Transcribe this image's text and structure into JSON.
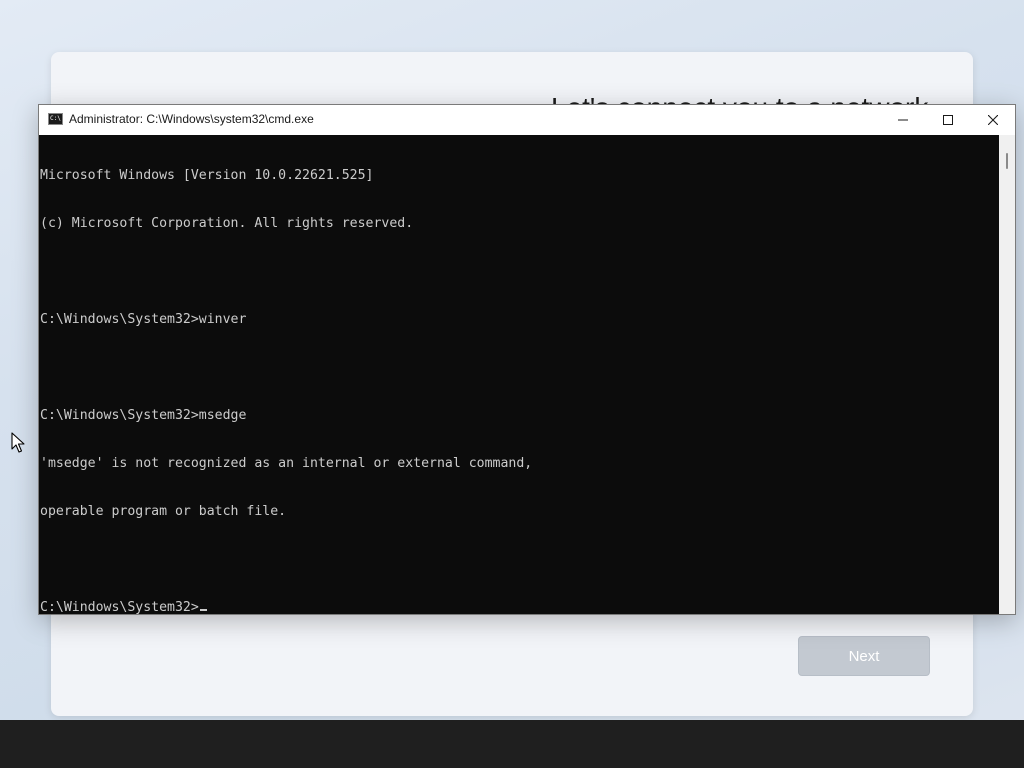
{
  "oobe": {
    "heading": "Let's connect you to a network",
    "next_label": "Next"
  },
  "cmd_window": {
    "title": "Administrator: C:\\Windows\\system32\\cmd.exe",
    "icon": "cmd-icon",
    "controls": {
      "minimize": "minimize-icon",
      "maximize": "maximize-icon",
      "close": "close-icon"
    },
    "console_lines": [
      "Microsoft Windows [Version 10.0.22621.525]",
      "(c) Microsoft Corporation. All rights reserved.",
      "",
      "C:\\Windows\\System32>winver",
      "",
      "C:\\Windows\\System32>msedge",
      "'msedge' is not recognized as an internal or external command,",
      "operable program or batch file.",
      "",
      "C:\\Windows\\System32>"
    ],
    "colors": {
      "console_bg": "#0c0c0c",
      "console_text": "#cccccc"
    }
  },
  "pointer": "mouse-pointer-icon"
}
